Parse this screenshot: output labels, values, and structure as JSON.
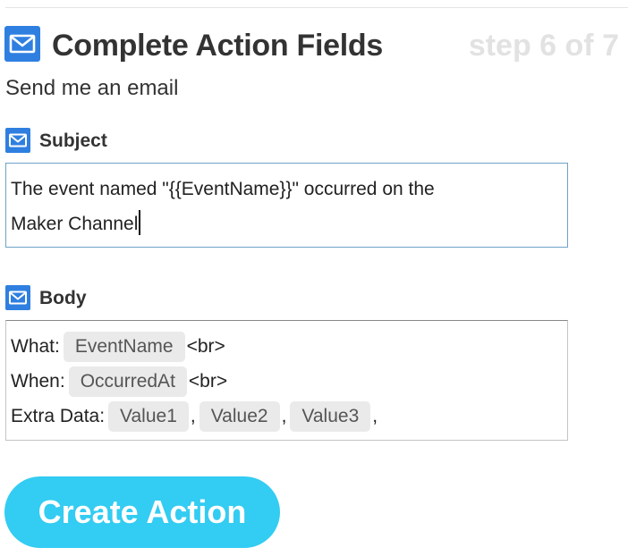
{
  "header": {
    "title": "Complete Action Fields",
    "step": "step 6 of 7",
    "subtitle": "Send me an email",
    "icon": "mail-icon"
  },
  "subject": {
    "label": "Subject",
    "icon": "mail-icon",
    "value_line1": "The event named \"{{EventName}}\" occurred on the",
    "value_line2": "Maker Channel"
  },
  "body": {
    "label": "Body",
    "icon": "mail-icon",
    "lines": [
      {
        "prefix": "What:",
        "ingredients": [
          "EventName"
        ],
        "suffix": "<br>"
      },
      {
        "prefix": "When:",
        "ingredients": [
          "OccurredAt"
        ],
        "suffix": "<br>"
      },
      {
        "prefix": "Extra Data:",
        "ingredients": [
          "Value1",
          "Value2",
          "Value3"
        ],
        "separator": ",",
        "suffix": ","
      }
    ]
  },
  "actions": {
    "create_label": "Create Action"
  },
  "colors": {
    "accent": "#33ccf2",
    "mail_icon_bg": "#2f7fe0",
    "input_border_focus": "#6fa2c7",
    "step_text": "#e2e2e2",
    "ingredient_bg": "#eaeaea"
  }
}
